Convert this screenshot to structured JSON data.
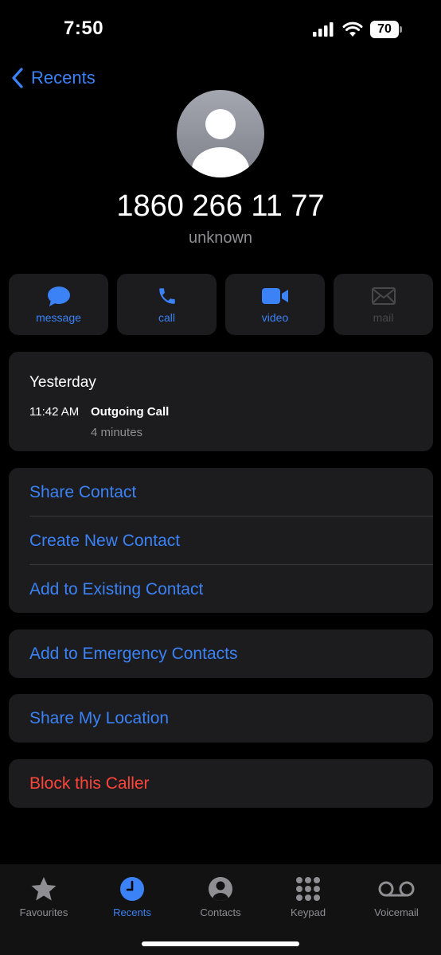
{
  "status": {
    "time": "7:50",
    "battery": "70"
  },
  "nav": {
    "back_label": "Recents"
  },
  "contact": {
    "number": "1860 266 11 77",
    "label": "unknown"
  },
  "actions": [
    {
      "label": "message",
      "icon": "message-icon",
      "enabled": true
    },
    {
      "label": "call",
      "icon": "phone-icon",
      "enabled": true
    },
    {
      "label": "video",
      "icon": "video-icon",
      "enabled": true
    },
    {
      "label": "mail",
      "icon": "mail-icon",
      "enabled": false
    }
  ],
  "history": {
    "day": "Yesterday",
    "time": "11:42 AM",
    "type": "Outgoing Call",
    "duration": "4 minutes"
  },
  "options": {
    "share_contact": "Share Contact",
    "create_contact": "Create New Contact",
    "add_existing": "Add to Existing Contact",
    "emergency": "Add to Emergency Contacts",
    "share_location": "Share My Location",
    "block": "Block this Caller"
  },
  "tabs": [
    {
      "label": "Favourites",
      "icon": "star-icon",
      "active": false
    },
    {
      "label": "Recents",
      "icon": "clock-icon",
      "active": true
    },
    {
      "label": "Contacts",
      "icon": "person-circle-icon",
      "active": false
    },
    {
      "label": "Keypad",
      "icon": "keypad-icon",
      "active": false
    },
    {
      "label": "Voicemail",
      "icon": "voicemail-icon",
      "active": false
    }
  ],
  "colors": {
    "accent": "#3b82f6",
    "destructive": "#ff453a",
    "card": "#1c1c1e",
    "background": "#000000"
  }
}
